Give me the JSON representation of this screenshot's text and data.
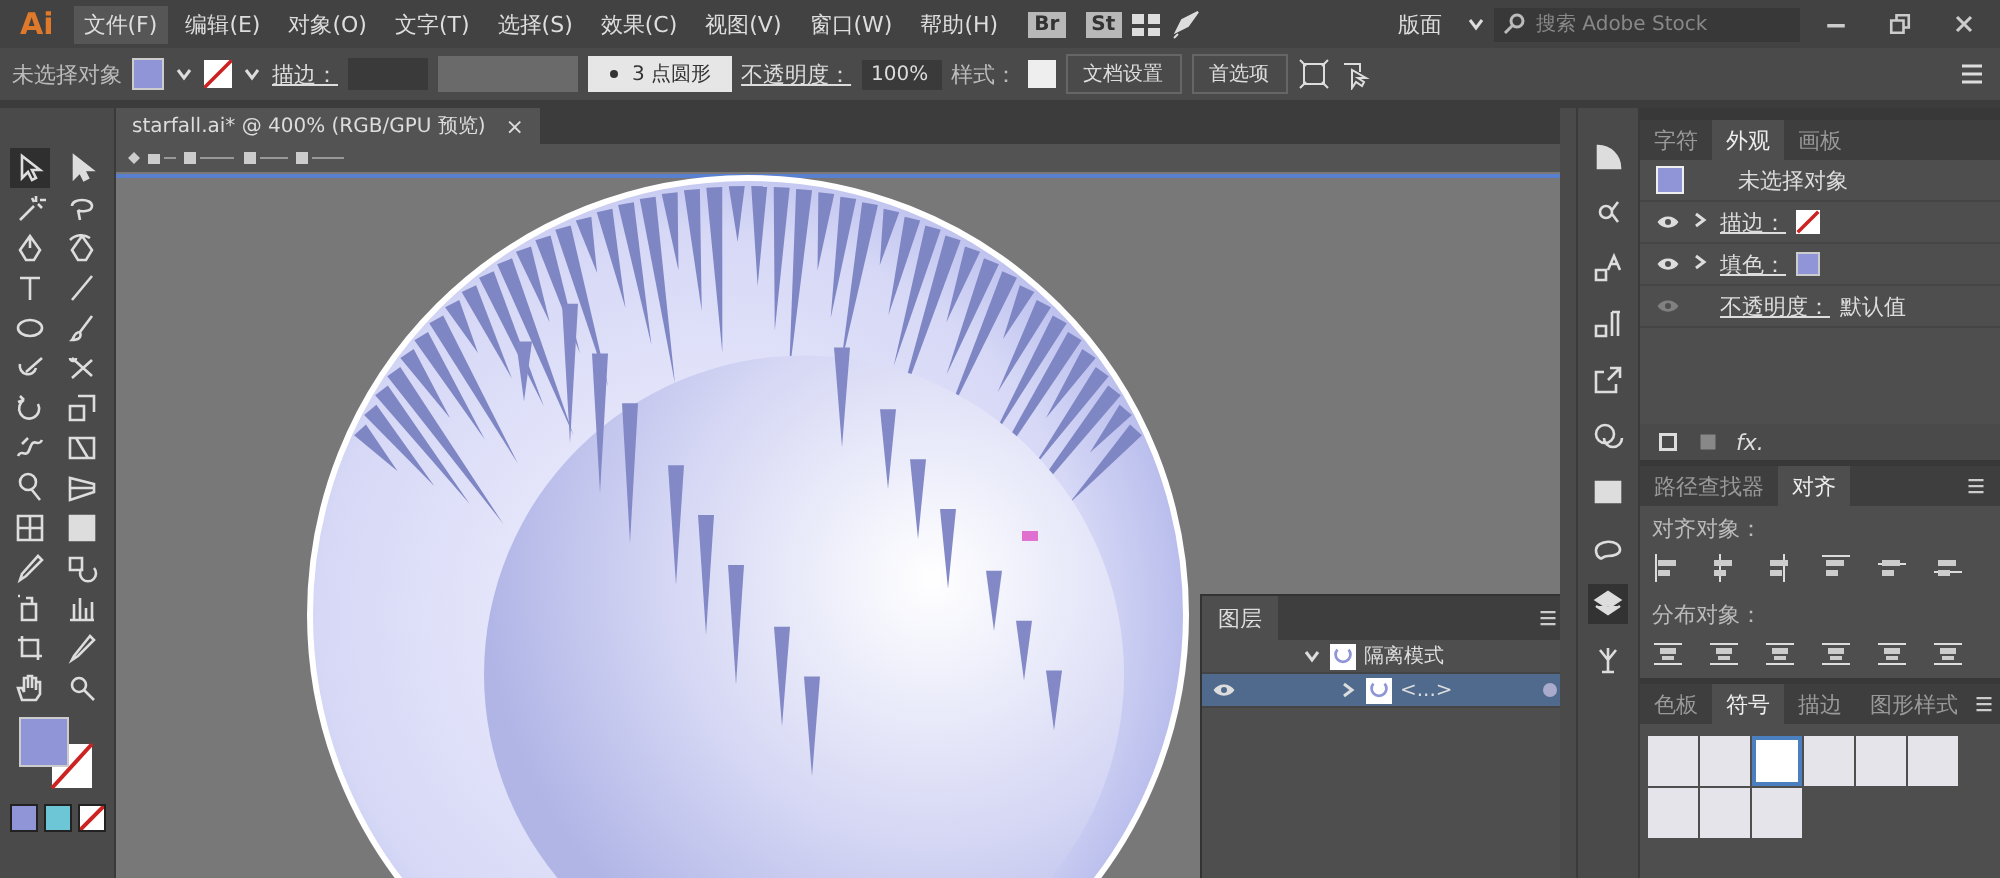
{
  "app": {
    "logo": "Ai",
    "menu": [
      {
        "label": "文件(F)",
        "selected": true
      },
      {
        "label": "编辑(E)",
        "selected": false
      },
      {
        "label": "对象(O)",
        "selected": false
      },
      {
        "label": "文字(T)",
        "selected": false
      },
      {
        "label": "选择(S)",
        "selected": false
      },
      {
        "label": "效果(C)",
        "selected": false
      },
      {
        "label": "视图(V)",
        "selected": false
      },
      {
        "label": "窗口(W)",
        "selected": false
      },
      {
        "label": "帮助(H)",
        "selected": false
      }
    ],
    "bridge_buttons": [
      "Br",
      "St"
    ],
    "workspace": "版面",
    "search": {
      "placeholder": "搜索 Adobe Stock"
    }
  },
  "control_bar": {
    "selection": "未选择对象",
    "stroke_label": "描边：",
    "brush": "3 点圆形",
    "opacity_label": "不透明度：",
    "opacity": "100%",
    "style_label": "样式：",
    "buttons": [
      "文档设置",
      "首选项"
    ]
  },
  "tools": [
    {
      "selected": true
    },
    {
      "selected": false
    },
    {
      "selected": false
    },
    {
      "selected": false
    },
    {
      "selected": false
    },
    {
      "selected": false
    },
    {
      "selected": false
    },
    {
      "selected": false
    },
    {
      "selected": false
    },
    {
      "selected": false
    },
    {
      "selected": false
    },
    {
      "selected": false
    },
    {
      "selected": false
    },
    {
      "selected": false
    },
    {
      "selected": false
    },
    {
      "selected": false
    },
    {
      "selected": false
    },
    {
      "selected": false
    },
    {
      "selected": false
    },
    {
      "selected": false
    },
    {
      "selected": false
    },
    {
      "selected": false
    },
    {
      "selected": false
    },
    {
      "selected": false
    },
    {
      "selected": false
    },
    {
      "selected": false
    },
    {
      "selected": false
    },
    {
      "selected": false
    }
  ],
  "document": {
    "tab": "starfall.ai* @ 400% (RGB/GPU 预览)",
    "close": "×"
  },
  "layers_panel": {
    "title": "图层",
    "rows": [
      {
        "label": "隔离模式",
        "expanded": true,
        "selected": false,
        "visible": false
      },
      {
        "label": "<...>",
        "expanded": false,
        "selected": true,
        "visible": true
      }
    ]
  },
  "appearance_panel": {
    "tabs": [
      {
        "label": "字符",
        "selected": false
      },
      {
        "label": "外观",
        "selected": true
      },
      {
        "label": "画板",
        "selected": false
      }
    ],
    "header": "未选择对象",
    "rows": [
      {
        "kind": "stroke",
        "label": "描边：",
        "visible": true
      },
      {
        "kind": "fill",
        "label": "填色：",
        "visible": true
      },
      {
        "kind": "opacity",
        "label": "不透明度：",
        "value": "默认值",
        "visible": false
      }
    ],
    "fx_label": "fx."
  },
  "align_panel": {
    "tabs": [
      {
        "label": "路径查找器",
        "selected": false
      },
      {
        "label": "对齐",
        "selected": true
      }
    ],
    "align_label": "对齐对象：",
    "distribute_label": "分布对象："
  },
  "symbols_panel": {
    "tabs": [
      {
        "label": "色板",
        "selected": false
      },
      {
        "label": "符号",
        "selected": true
      },
      {
        "label": "描边",
        "selected": false
      },
      {
        "label": "图形样式",
        "selected": false
      }
    ],
    "symbols": [
      {
        "selected": false
      },
      {
        "selected": false
      },
      {
        "selected": true
      },
      {
        "selected": false
      },
      {
        "selected": false
      },
      {
        "selected": false
      },
      {
        "selected": false
      },
      {
        "selected": false
      },
      {
        "selected": false
      }
    ]
  }
}
